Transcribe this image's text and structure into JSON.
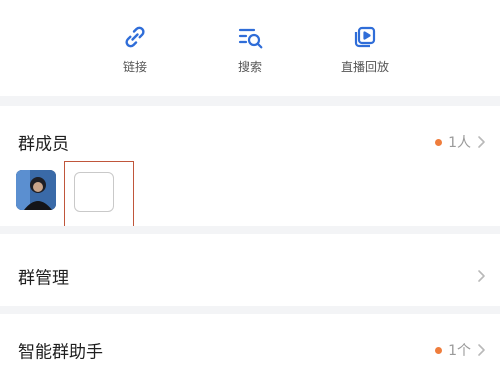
{
  "quick_actions": [
    {
      "label": "链接",
      "icon": "link-icon"
    },
    {
      "label": "搜索",
      "icon": "search-list-icon"
    },
    {
      "label": "直播回放",
      "icon": "live-replay-icon"
    }
  ],
  "members": {
    "title": "群成员",
    "count": "1人",
    "avatar": "member-avatar",
    "add_slot": "add-member-slot"
  },
  "group_manage": {
    "title": "群管理"
  },
  "assistant": {
    "title": "智能群助手",
    "count": "1个"
  },
  "colors": {
    "accent_icon": "#2f6dd8",
    "badge_dot": "#ef7d3c",
    "highlight_box": "#c0563b",
    "divider": "#f3f4f6"
  }
}
